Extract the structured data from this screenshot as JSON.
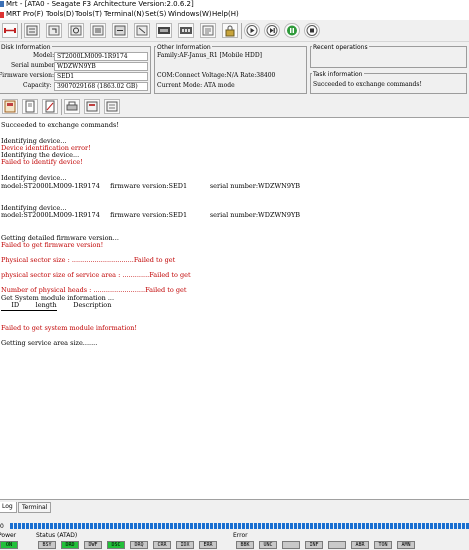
{
  "window": {
    "title": "Mrt - [ATA0 - Seagate F3 Architecture Version:2.0.6.2]"
  },
  "menu": [
    "MRT Pro(F)",
    "Tools(D)",
    "Tools(T)",
    "Terminal(N)",
    "Set(S)",
    "Windows(W)",
    "Help(H)"
  ],
  "toolbar": {
    "icons": [
      "connect-icon",
      "read-id-icon",
      "reset-icon",
      "power-off-icon",
      "settings-icon",
      "module-icon",
      "hex-icon",
      "tools-icon",
      "memory-icon",
      "terminal-icon",
      "play-icon",
      "step-icon",
      "pause-icon",
      "stop-icon",
      "lock-icon"
    ]
  },
  "disk_info": {
    "legend": "Disk Information",
    "model_label": "Model:",
    "model": "ST2000LM009-1R9174",
    "serial_label": "Serial number:",
    "serial": "WDZWN9YB",
    "firmware_label": "Firmware version:",
    "firmware": "SED1",
    "capacity_label": "Capacity:",
    "capacity": "3907029168 (1863.02 GB)"
  },
  "other_info": {
    "legend": "Other Information",
    "family": "Family:AF-Janus_R1 [Mobile HDD]",
    "com": "COM:Connect Voltage:N/A Rate:38400",
    "mode": "Current Mode: ATA mode"
  },
  "recent": {
    "legend": "Recent operations"
  },
  "task": {
    "legend": "Task information",
    "text": "Succeeded to exchange commands!"
  },
  "toolbar2": {
    "icons": [
      "save-icon",
      "copy-icon",
      "clear-icon",
      "print-icon",
      "open-icon",
      "list-icon"
    ]
  },
  "log": {
    "l1": "Succeeded to exchange commands!",
    "l2": "Identifying device...",
    "l3": "Device identification error!",
    "l4": "Identifying the device...",
    "l5": "Failed to identify device!",
    "l6": "Identifying device...",
    "l7": "model:ST2000LM009-1R9174     firmware version:SED1           serial number:WDZWN9YB",
    "l8": "Identifying device...",
    "l9": "model:ST2000LM009-1R9174     firmware version:SED1           serial number:WDZWN9YB",
    "l10": "Getting detailed firmware version...",
    "l11": "Failed to get firmware version!",
    "l12": "Physical sector size : ..............................Failed to get",
    "l13": "physical sector size of service area : .............Failed to get",
    "l14": "Number of physical heads : .........................Failed to get",
    "l15": "Get System module information ...",
    "l16": "     ID        length        Description",
    "l17": "Failed to get system module information!",
    "l18": "Getting service area size......."
  },
  "tabs": [
    "Log",
    "Terminal"
  ],
  "progress": {
    "label": "0",
    "fraction": 1.0
  },
  "status": {
    "power_label": "Power",
    "power_value": "ON",
    "status_label": "Status (ATAD)",
    "status_regs": [
      "BSY",
      "DRD",
      "DWF",
      "DSC",
      "DRQ",
      "CRR",
      "IDX",
      "ERR"
    ],
    "error_label": "Error",
    "error_regs": [
      "BBK",
      "UNC",
      "",
      "INF",
      "",
      "ABR",
      "TON",
      "AMN"
    ]
  },
  "colors": {
    "log_error": "#c00000",
    "led_on": "#22c03a",
    "led_off": "#c9c9c9",
    "progress": "#1a6fd0"
  }
}
